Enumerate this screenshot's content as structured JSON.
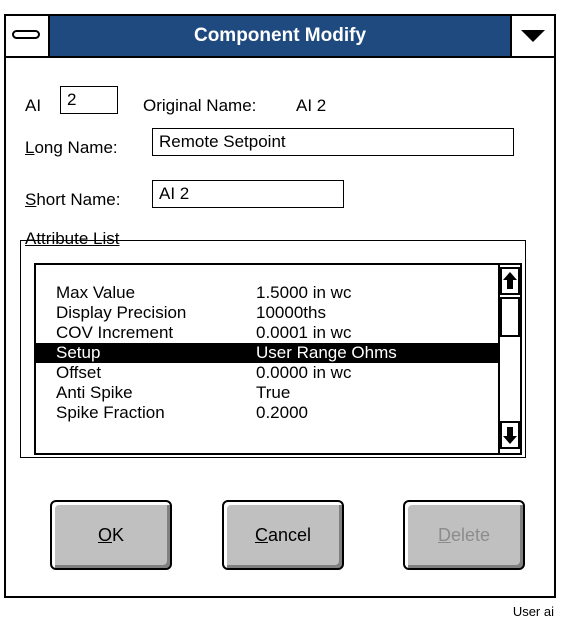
{
  "window": {
    "title": "Component Modify"
  },
  "header": {
    "ai_label": "AI",
    "ai_value": "2",
    "original_name_label": "Original Name:",
    "original_name_value": "AI 2"
  },
  "fields": {
    "long_name_label_underlined": "L",
    "long_name_label_rest": "ong Name:",
    "long_name_value": "Remote Setpoint",
    "short_name_label_underlined": "S",
    "short_name_label_rest": "hort Name:",
    "short_name_value": "AI 2"
  },
  "attribute_list": {
    "label": "Attribute List",
    "rows": [
      {
        "name": "Max Value",
        "value": "1.5000 in wc",
        "selected": false
      },
      {
        "name": "Display Precision",
        "value": "10000ths",
        "selected": false
      },
      {
        "name": "COV Increment",
        "value": "0.0001 in wc",
        "selected": false
      },
      {
        "name": "Setup",
        "value": "User Range Ohms",
        "selected": true
      },
      {
        "name": "Offset",
        "value": "0.0000 in wc",
        "selected": false
      },
      {
        "name": "Anti Spike",
        "value": "True",
        "selected": false
      },
      {
        "name": "Spike Fraction",
        "value": "0.2000",
        "selected": false
      }
    ],
    "scroll_up_icon": "arrow-up-icon",
    "scroll_down_icon": "arrow-down-icon"
  },
  "buttons": {
    "ok_underlined": "O",
    "ok_rest": "K",
    "cancel_underlined": "C",
    "cancel_rest": "ancel",
    "delete_underlined": "D",
    "delete_rest": "elete",
    "delete_enabled": false
  },
  "caption": "User ai",
  "colors": {
    "titlebar": "#1e4a80",
    "selection": "#000000",
    "button_face": "#c0c0c0",
    "disabled_text": "#8c8c8c"
  }
}
